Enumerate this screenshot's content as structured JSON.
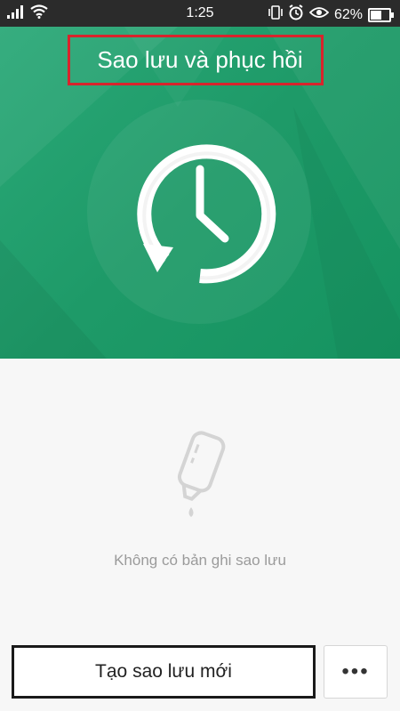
{
  "status_bar": {
    "time": "1:25",
    "battery_percent": "62%",
    "battery_level": 0.62,
    "icons": [
      "signal-icon",
      "wifi-icon",
      "vibrate-icon",
      "alarm-icon",
      "eye-icon",
      "battery-icon"
    ]
  },
  "header": {
    "title": "Sao lưu và phục hồi",
    "hero_icon": "backup-clock-icon",
    "hero_color": "#1e9a68",
    "highlight_color": "#d8242c"
  },
  "empty_state": {
    "icon": "empty-bottle-icon",
    "message": "Không có bản ghi sao lưu"
  },
  "actions": {
    "create_backup_label": "Tạo sao lưu mới",
    "more_label": "•••"
  }
}
